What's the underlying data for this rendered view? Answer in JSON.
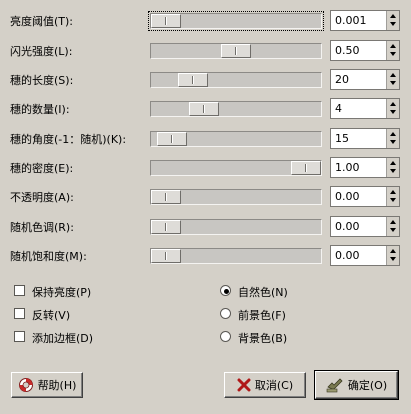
{
  "sliders": [
    {
      "label": "亮度阈值(T):",
      "value": "0.001",
      "fraction": 0.0
    },
    {
      "label": "闪光强度(L):",
      "value": "0.50",
      "fraction": 0.5
    },
    {
      "label": "穗的长度(S):",
      "value": "20",
      "fraction": 0.19
    },
    {
      "label": "穗的数量(I):",
      "value": "4",
      "fraction": 0.27
    },
    {
      "label": "穗的角度(-1：随机)(K):",
      "value": "15",
      "fraction": 0.04
    },
    {
      "label": "穗的密度(E):",
      "value": "1.00",
      "fraction": 1.0
    },
    {
      "label": "不透明度(A):",
      "value": "0.00",
      "fraction": 0.0
    },
    {
      "label": "随机色调(R):",
      "value": "0.00",
      "fraction": 0.0
    },
    {
      "label": "随机饱和度(M):",
      "value": "0.00",
      "fraction": 0.0
    }
  ],
  "checkboxes": [
    {
      "label": "保持亮度(P)",
      "checked": false
    },
    {
      "label": "反转(V)",
      "checked": false
    },
    {
      "label": "添加边框(D)",
      "checked": false
    }
  ],
  "radios": [
    {
      "label": "自然色(N)",
      "selected": true
    },
    {
      "label": "前景色(F)",
      "selected": false
    },
    {
      "label": "背景色(B)",
      "selected": false
    }
  ],
  "buttons": {
    "help": "帮助(H)",
    "cancel": "取消(C)",
    "ok": "确定(O)"
  }
}
